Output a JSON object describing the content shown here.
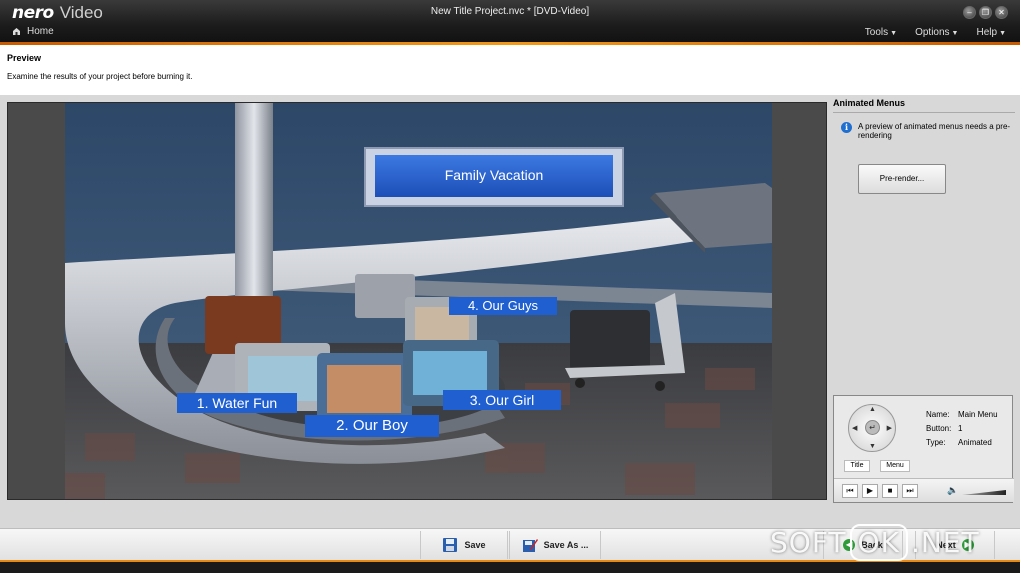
{
  "app": {
    "logo_brand": "nero",
    "logo_product": "Video",
    "window_title": "New Title Project.nvc * [DVD-Video]",
    "home_label": "Home",
    "menu": [
      {
        "label": "Tools"
      },
      {
        "label": "Options"
      },
      {
        "label": "Help"
      }
    ]
  },
  "header": {
    "title": "Preview",
    "description": "Examine the results of your project before burning it."
  },
  "scene": {
    "sign": "Family Vacation",
    "buttons": [
      "1. Water Fun",
      "2. Our Boy",
      "3. Our Girl",
      "4. Our Guys"
    ]
  },
  "animated_menus": {
    "title": "Animated Menus",
    "info": "A preview of animated menus needs a pre-rendering",
    "prerender_label": "Pre-render..."
  },
  "remote": {
    "name_key": "Name:",
    "name_value": "Main Menu",
    "button_key": "Button:",
    "button_value": "1",
    "type_key": "Type:",
    "type_value": "Animated",
    "title_btn": "Title",
    "menu_btn": "Menu"
  },
  "bottom": {
    "save": "Save",
    "save_as": "Save As ...",
    "back": "Back",
    "next": "Next"
  },
  "watermark": {
    "a": "SOFT",
    "b": "OK",
    "c": ".NET"
  },
  "colors": {
    "accent": "#f29a1a",
    "button_blue": "#1f5fd0"
  }
}
